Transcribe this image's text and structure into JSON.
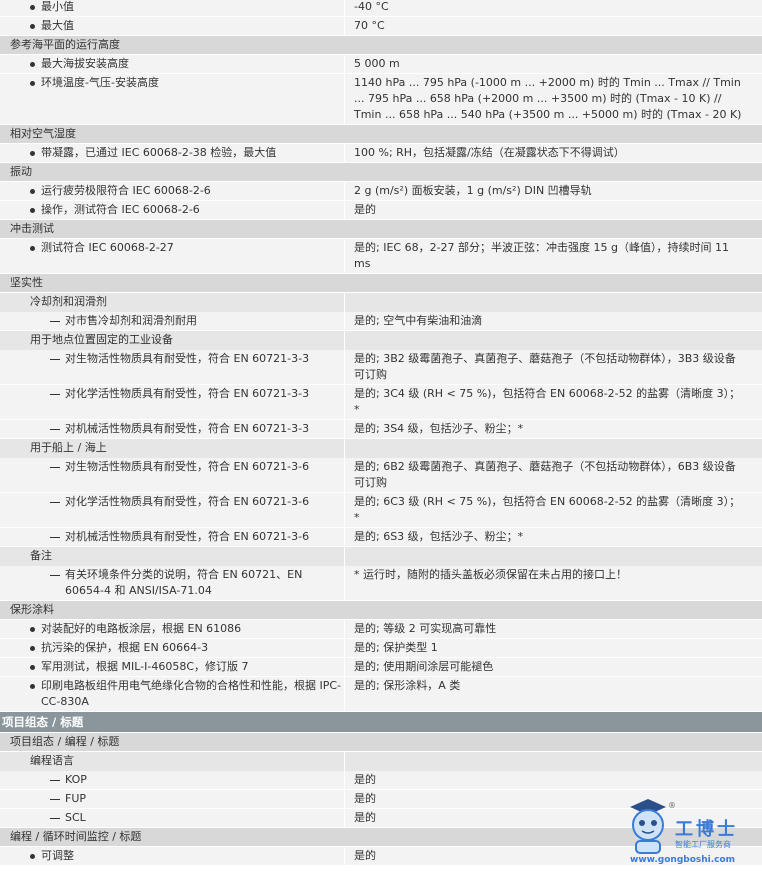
{
  "rows": [
    {
      "kind": "bullet",
      "label": "最小值",
      "value": "-40 °C"
    },
    {
      "kind": "bullet",
      "label": "最大值",
      "value": "70 °C"
    },
    {
      "kind": "hdr1",
      "label": "参考海平面的运行高度"
    },
    {
      "kind": "bullet",
      "label": "最大海拔安装高度",
      "value": "5 000 m"
    },
    {
      "kind": "bullet",
      "label": "环境温度-气压-安装高度",
      "value": "1140 hPa ... 795 hPa (-1000 m ... +2000 m) 时的 Tmin ... Tmax // Tmin ... 795 hPa ... 658 hPa (+2000 m ... +3500 m) 时的 (Tmax - 10 K) // Tmin ... 658 hPa ... 540 hPa (+3500 m ... +5000 m) 时的 (Tmax - 20 K)"
    },
    {
      "kind": "hdr1",
      "label": "相对空气湿度"
    },
    {
      "kind": "bullet",
      "label": "带凝露，已通过 IEC 60068-2-38 检验，最大值",
      "value": "100 %; RH，包括凝露/冻结（在凝露状态下不得调试）"
    },
    {
      "kind": "hdr1",
      "label": "振动"
    },
    {
      "kind": "bullet",
      "label": "运行疲劳极限符合 IEC 60068-2-6",
      "value": "2 g (m/s²) 面板安装，1 g (m/s²) DIN 凹槽导轨"
    },
    {
      "kind": "bullet",
      "label": "操作，测试符合 IEC 60068-2-6",
      "value": "是的"
    },
    {
      "kind": "hdr1",
      "label": "冲击测试"
    },
    {
      "kind": "bullet",
      "label": "测试符合 IEC 60068-2-27",
      "value": "是的; IEC 68，2-27 部分；半波正弦：冲击强度 15 g（峰值），持续时间 11 ms"
    },
    {
      "kind": "hdr1",
      "label": "坚实性"
    },
    {
      "kind": "hdr2",
      "label": "冷却剂和润滑剂"
    },
    {
      "kind": "dash",
      "label": "对市售冷却剂和润滑剂耐用",
      "value": "是的; 空气中有柴油和油滴"
    },
    {
      "kind": "hdr2",
      "label": "用于地点位置固定的工业设备"
    },
    {
      "kind": "dash",
      "label": "对生物活性物质具有耐受性，符合 EN 60721-3-3",
      "value": "是的; 3B2 级霉菌孢子、真菌孢子、蘑菇孢子（不包括动物群体），3B3 级设备可订购"
    },
    {
      "kind": "dash",
      "label": "对化学活性物质具有耐受性，符合 EN 60721-3-3",
      "value": "是的; 3C4 级 (RH < 75 %)，包括符合 EN 60068-2-52 的盐雾（清晰度 3）；*"
    },
    {
      "kind": "dash",
      "label": "对机械活性物质具有耐受性，符合 EN 60721-3-3",
      "value": "是的; 3S4 级，包括沙子、粉尘；*"
    },
    {
      "kind": "hdr2",
      "label": "用于船上 / 海上"
    },
    {
      "kind": "dash",
      "label": "对生物活性物质具有耐受性，符合 EN 60721-3-6",
      "value": "是的; 6B2 级霉菌孢子、真菌孢子、蘑菇孢子（不包括动物群体），6B3 级设备可订购"
    },
    {
      "kind": "dash",
      "label": "对化学活性物质具有耐受性，符合 EN 60721-3-6",
      "value": "是的; 6C3 级 (RH < 75 %)，包括符合 EN 60068-2-52 的盐雾（清晰度 3）；*"
    },
    {
      "kind": "dash",
      "label": "对机械活性物质具有耐受性，符合 EN 60721-3-6",
      "value": "是的; 6S3 级，包括沙子、粉尘；*"
    },
    {
      "kind": "hdr2",
      "label": "备注"
    },
    {
      "kind": "dash",
      "label": "有关环境条件分类的说明，符合 EN 60721、EN 60654-4 和 ANSI/ISA-71.04",
      "value": "* 运行时，随附的插头盖板必须保留在未占用的接口上！"
    },
    {
      "kind": "hdr1",
      "label": "保形涂料"
    },
    {
      "kind": "bullet",
      "label": "对装配好的电路板涂层，根据 EN 61086",
      "value": "是的; 等级 2 可实现高可靠性"
    },
    {
      "kind": "bullet",
      "label": "抗污染的保护，根据 EN 60664-3",
      "value": "是的; 保护类型 1"
    },
    {
      "kind": "bullet",
      "label": "军用测试，根据 MIL-I-46058C，修订版 7",
      "value": "是的; 使用期间涂层可能褪色"
    },
    {
      "kind": "bullet",
      "label": "印刷电路板组件用电气绝缘化合物的合格性和性能，根据 IPC-CC-830A",
      "value": "是的; 保形涂料，A 类"
    },
    {
      "kind": "sect",
      "label": "项目组态 / 标题"
    },
    {
      "kind": "hdr1",
      "label": "项目组态 / 编程 / 标题"
    },
    {
      "kind": "hdr2",
      "label": "编程语言"
    },
    {
      "kind": "dash",
      "label": "KOP",
      "value": "是的"
    },
    {
      "kind": "dash",
      "label": "FUP",
      "value": "是的"
    },
    {
      "kind": "dash",
      "label": "SCL",
      "value": "是的"
    },
    {
      "kind": "hdr1",
      "label": "编程 / 循环时间监控 / 标题"
    },
    {
      "kind": "bullet",
      "label": "可调整",
      "value": "是的"
    }
  ],
  "logo": {
    "brand": "工博士",
    "reg": "®",
    "subtitle": "智能工厂服务商",
    "url": "www.gongboshi.com"
  },
  "colors": {
    "header_bg": "#d8d8d8",
    "row_bg": "#f3f3f3",
    "section_bg": "#8a969c",
    "logo_blue": "#3a7bd5"
  }
}
